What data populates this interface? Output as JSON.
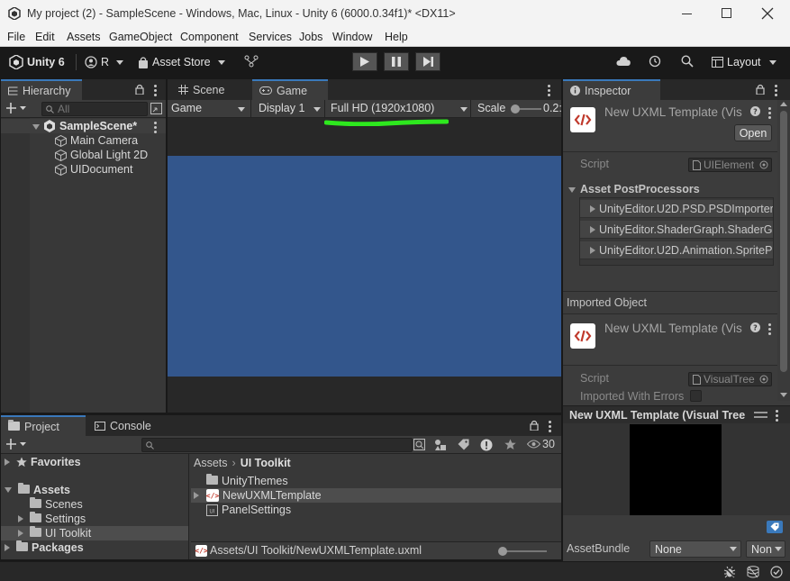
{
  "window": {
    "title": "My project (2) - SampleScene - Windows, Mac, Linux - Unity 6 (6000.0.34f1)* <DX11>",
    "controls": [
      "minimize-icon",
      "maximize-icon",
      "close-icon"
    ]
  },
  "menu": [
    "File",
    "Edit",
    "Assets",
    "GameObject",
    "Component",
    "Services",
    "Jobs",
    "Window",
    "Help"
  ],
  "toolbar": {
    "unity_label": "Unity 6",
    "account_label": "R",
    "asset_store_label": "Asset Store",
    "layout_label": "Layout"
  },
  "hierarchy": {
    "tab_label": "Hierarchy",
    "search_placeholder": "All",
    "scene_name": "SampleScene*",
    "items": [
      "Main Camera",
      "Global Light 2D",
      "UIDocument"
    ]
  },
  "game_view": {
    "tabs": [
      "Scene",
      "Game"
    ],
    "mode_dropdown": "Game",
    "display_dropdown": "Display 1",
    "resolution_dropdown": "Full HD (1920x1080)",
    "scale_label": "Scale",
    "scale_value": "0.2:",
    "viewport_color": "#33568c",
    "highlight_color": "#2ee81e"
  },
  "inspector": {
    "tab_label": "Inspector",
    "asset_title": "New UXML Template (Vis",
    "open_button": "Open",
    "script_label": "Script",
    "script_value": "UIElement",
    "postprocessors_label": "Asset PostProcessors",
    "postprocessors": [
      "UnityEditor.U2D.PSD.PSDImporter/",
      "UnityEditor.ShaderGraph.ShaderGr",
      "UnityEditor.U2D.Animation.SpriteP"
    ],
    "imported_object_label": "Imported Object",
    "imported_title": "New UXML Template (Vis",
    "imported_script_label": "Script",
    "imported_script_value": "VisualTree",
    "imported_with_errors_label": "Imported With Errors",
    "preview_title": "New UXML Template (Visual Tree",
    "assetbundle_label": "AssetBundle",
    "assetbundle_value": "None",
    "assetbundle_variant": "Non"
  },
  "project": {
    "tabs": [
      "Project",
      "Console"
    ],
    "hidden_count": "30",
    "favorites_label": "Favorites",
    "assets_label": "Assets",
    "asset_folders": [
      "Scenes",
      "Settings",
      "UI Toolkit"
    ],
    "packages_label": "Packages",
    "breadcrumb": [
      "Assets",
      "UI Toolkit"
    ],
    "files": [
      "UnityThemes",
      "NewUXMLTemplate",
      "PanelSettings"
    ],
    "selected_path": "Assets/UI Toolkit/NewUXMLTemplate.uxml"
  }
}
